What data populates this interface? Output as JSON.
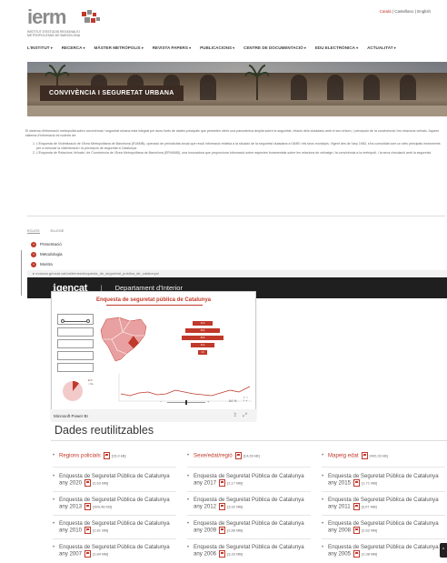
{
  "ierm": {
    "logo": "ierm",
    "logo_sub": "INSTITUT D'ESTUDIS REGIONALS I METROPOLITANS DE BARCELONA",
    "lang": {
      "ca": "Català",
      "es": "Castellano",
      "en": "English"
    },
    "nav": [
      "L'INSTITUT",
      "RECERCA",
      "MÀSTER METRÒPOLIS",
      "REVISTA PAPERS",
      "PUBLICACIONS",
      "CENTRE DE DOCUMENTACIÓ",
      "EDU ELECTRÒNICA",
      "ACTUALITAT"
    ],
    "hero_title": "CONVIVÈNCIA I SEGURETAT URBANA",
    "intro_paragraph": "El sistema d'informació metropolità sobre convivència i seguretat urbana està integrat per dues fonts de dades principals que permeten oferir una panoràmica àmplia sobre la seguretat, relació dels ciutadans amb el seu entorn, i percepció de la convivència i les relacions veïnals. Aquest sistema d'informació es nodreix de:",
    "intro_items": [
      "L'Enquesta de Victimització de l'Àrea Metropolitana de Barcelona (EVAMB), operació de periodicitat anual que recull informació relativa a la situació de la seguretat ciutadana a l'AMB i els seus municipis. Vigent des de l'any 1983, s'ha consolidat com un dels principals instruments per a mesurar la victimització i la percepció de seguretat a Catalunya.",
      "L'Enquesta de Relacions Veïnals i de Convivència de l'Àrea Metropolitana de Barcelona (ERVAMB), una innovadora que proporciona informació sobre aspectes fonamentals sobre les relacions de veïnatge i la convivència a la metròpoli, i la seva vinculació amb la seguretat."
    ],
    "tabs": [
      "ECUOS",
      "ELLEGE"
    ],
    "menu": [
      "Presentació",
      "Metodologia",
      "Mostra"
    ]
  },
  "browser": {
    "url": "▸ mossos.gencat.cat/ca/temes/enquesta_de_seguretat_publica_de_catalunya/"
  },
  "gencat": {
    "logo_pre": "ℹ",
    "logo": "gencat",
    "department": "Departament d'Interior"
  },
  "powerbi": {
    "title": "Enquesta de seguretat pública de Catalunya",
    "footer_label": "Microsoft Power BI",
    "zoom": "64 %",
    "funnel_values": [
      "14,6",
      "28,5",
      "39,5",
      "13,4",
      "4,0"
    ],
    "pie_legend": [
      "Sí",
      "No"
    ]
  },
  "dades": {
    "title": "Dades reutilitzables",
    "links": [
      {
        "label": "Regions policials",
        "size": "[15,9 kB]"
      },
      {
        "label": "Sexe/edat/regió",
        "size": "[14,69 kB]"
      },
      {
        "label": "Mapeig edat",
        "size": "[442,03 kB]"
      }
    ],
    "rows": [
      [
        {
          "line1": "Enquesta de Seguretat Pública de Catalunya",
          "line2": "any 2020",
          "size": "[2,63 MB]"
        },
        {
          "line1": "Enquesta de Seguretat Pública de Catalunya",
          "line2": "any 2017",
          "size": "[2,17 MB]"
        },
        {
          "line1": "Enquesta de Seguretat Pública de Catalunya",
          "line2": "any 2015",
          "size": "[1,71 MB]"
        }
      ],
      [
        {
          "line1": "Enquesta de Seguretat Pública de Catalunya",
          "line2": "any 2013",
          "size": "[999,48 KB]"
        },
        {
          "line1": "Enquesta de Seguretat Pública de Catalunya",
          "line2": "any 2012",
          "size": "[3,92 MB]"
        },
        {
          "line1": "Enquesta de Seguretat Pública de Catalunya",
          "line2": "any 2011",
          "size": "[3,07 MB]"
        }
      ],
      [
        {
          "line1": "Enquesta de Seguretat Pública de Catalunya",
          "line2": "any 2010",
          "size": "[2,81 MB]"
        },
        {
          "line1": "Enquesta de Seguretat Pública de Catalunya",
          "line2": "any 2009",
          "size": "[2,86 MB]"
        },
        {
          "line1": "Enquesta de Seguretat Pública de Catalunya",
          "line2": "any 2008",
          "size": "[2,62 MB]"
        }
      ],
      [
        {
          "line1": "Enquesta de Seguretat Pública de Catalunya",
          "line2": "any 2007",
          "size": "[2,84 MB]"
        },
        {
          "line1": "Enquesta de Seguretat Pública de Catalunya",
          "line2": "any 2006",
          "size": "[3,33 MB]"
        },
        {
          "line1": "Enquesta de Seguretat Pública de Catalunya",
          "line2": "any 2005",
          "size": "[2,38 MB]"
        }
      ]
    ],
    "pdf_label": "pdf"
  },
  "colors": {
    "accent": "#c0392b",
    "gencat_bar": "#1f1f1f"
  },
  "icons": {
    "pdf": "pdf-icon",
    "scroll_top": "chevron-up-icon",
    "expand": "expand-icon",
    "share": "share-icon"
  }
}
